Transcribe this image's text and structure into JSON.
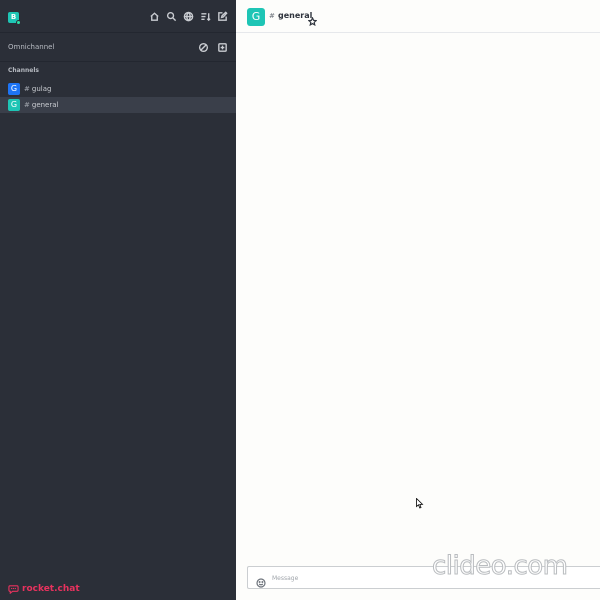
{
  "sidebar": {
    "user_avatar_letter": "B",
    "header_icons": [
      "home-icon",
      "search-icon",
      "directory-icon",
      "sort-icon",
      "create-new-icon"
    ],
    "omnichannel": {
      "label": "Omnichannel",
      "icons": [
        "omnichannel-status-icon",
        "omnichannel-queue-icon"
      ]
    },
    "channels_title": "Channels",
    "rooms": [
      {
        "avatar_letter": "G",
        "avatar_color": "#1d74f5",
        "icon": "#",
        "name": "gulag",
        "active": false
      },
      {
        "avatar_letter": "G",
        "avatar_color": "#1ec5b5",
        "icon": "#",
        "name": "general",
        "active": true
      }
    ],
    "brand": {
      "text": "rocket.chat",
      "color": "#e8325e"
    }
  },
  "room_header": {
    "avatar_letter": "G",
    "icon": "#",
    "title": "general",
    "favorite_icon": "star-icon"
  },
  "composer": {
    "placeholder": "Message",
    "emoji_icon": "emoji-icon"
  },
  "watermark": "clideo.com",
  "colors": {
    "sidebar_bg": "#2b2f38",
    "accent": "#1ec5b5",
    "main_bg": "#fdfdfb"
  }
}
